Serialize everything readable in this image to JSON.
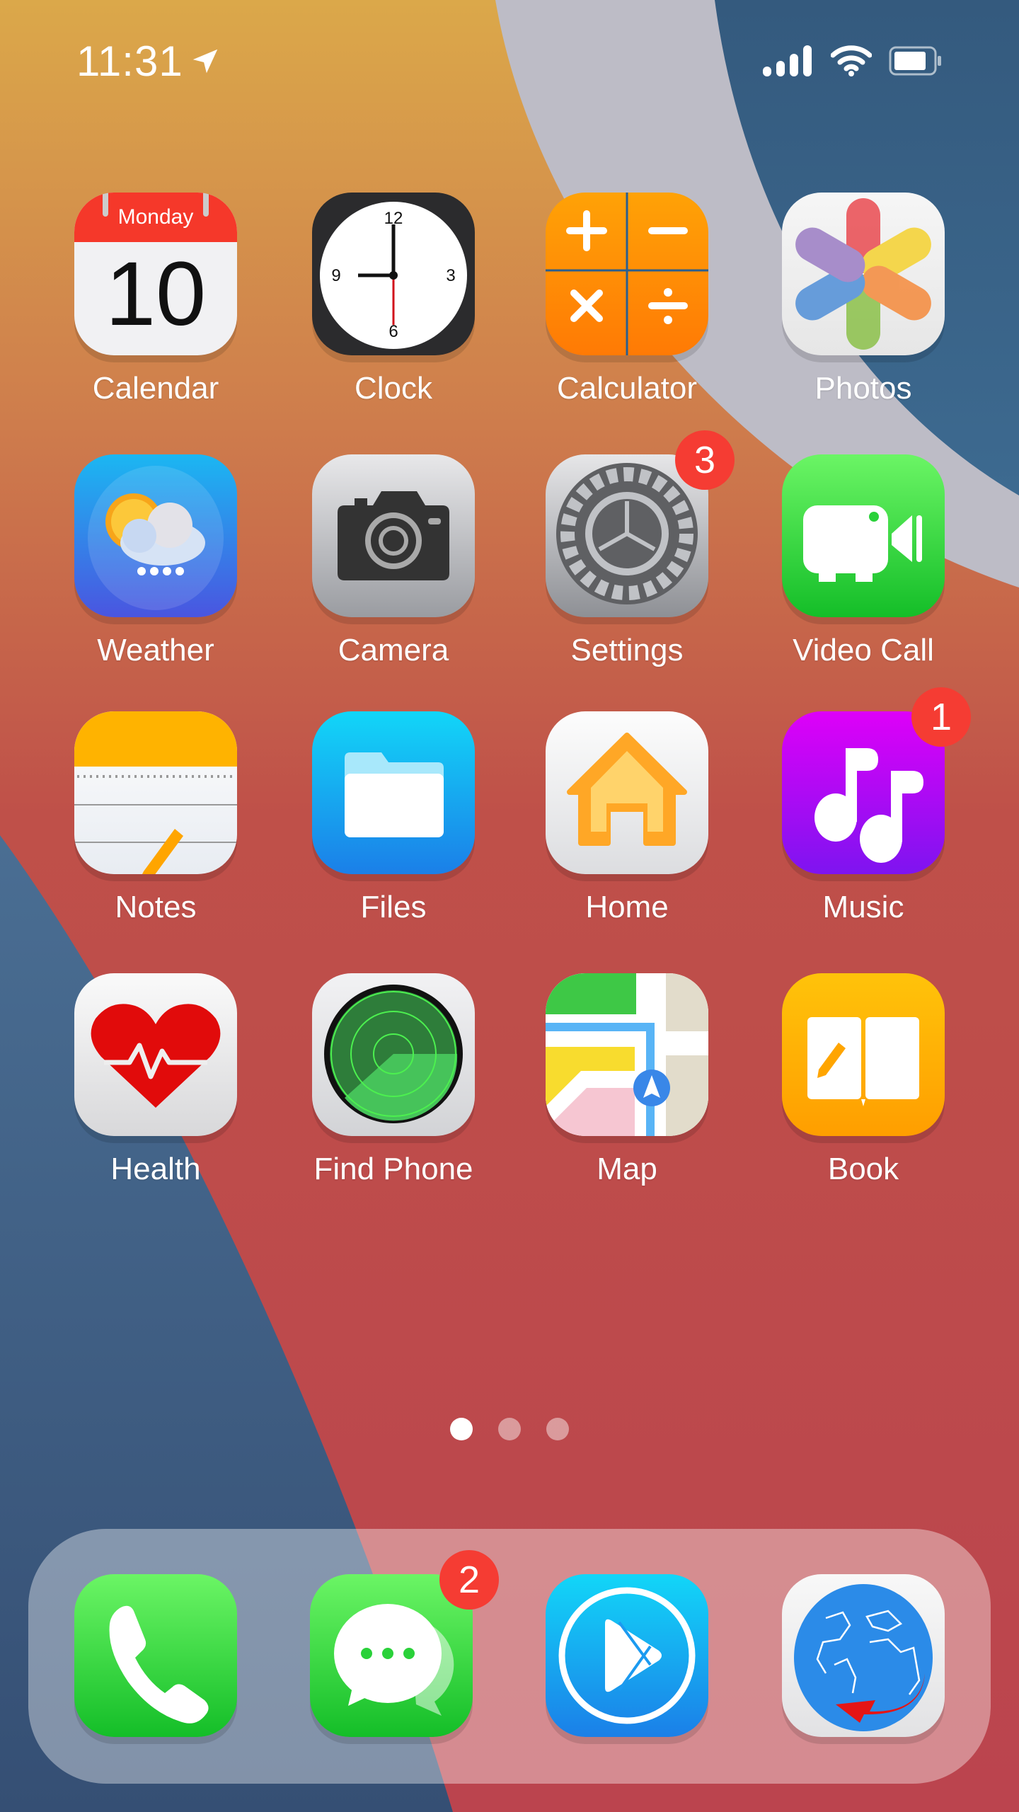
{
  "status_bar": {
    "time": "11:31",
    "location_icon": "location-arrow-icon",
    "signal_icon": "cellular-signal-icon",
    "wifi_icon": "wifi-icon",
    "battery_icon": "battery-icon"
  },
  "calendar_icon": {
    "weekday": "Monday",
    "day": "10"
  },
  "clock_icon": {
    "numerals": [
      "12",
      "3",
      "6",
      "9"
    ]
  },
  "apps": [
    {
      "label": "Calendar",
      "icon": "calendar-icon"
    },
    {
      "label": "Clock",
      "icon": "clock-icon"
    },
    {
      "label": "Calculator",
      "icon": "calculator-icon"
    },
    {
      "label": "Photos",
      "icon": "photos-icon"
    },
    {
      "label": "Weather",
      "icon": "weather-icon"
    },
    {
      "label": "Camera",
      "icon": "camera-icon"
    },
    {
      "label": "Settings",
      "icon": "gear-icon",
      "badge": "3"
    },
    {
      "label": "Video Call",
      "icon": "video-camera-icon"
    },
    {
      "label": "Notes",
      "icon": "notes-icon"
    },
    {
      "label": "Files",
      "icon": "folder-icon"
    },
    {
      "label": "Home",
      "icon": "house-icon"
    },
    {
      "label": "Music",
      "icon": "music-note-icon",
      "badge": "1"
    },
    {
      "label": "Health",
      "icon": "heart-icon"
    },
    {
      "label": "Find Phone",
      "icon": "radar-icon"
    },
    {
      "label": "Map",
      "icon": "map-icon"
    },
    {
      "label": "Book",
      "icon": "book-icon"
    }
  ],
  "page_indicator": {
    "total": 3,
    "current": 1
  },
  "dock": [
    {
      "name": "Phone",
      "icon": "phone-icon"
    },
    {
      "name": "Messages",
      "icon": "message-bubble-icon",
      "badge": "2"
    },
    {
      "name": "Play Store",
      "icon": "play-icon"
    },
    {
      "name": "Browser",
      "icon": "globe-icon"
    }
  ],
  "colors": {
    "badge": "#f53c33",
    "wallpaper_orange": "#d9a54a",
    "wallpaper_red": "#bc464c",
    "wallpaper_blue": "#345a7e",
    "wallpaper_gray": "#bdbcc6"
  }
}
